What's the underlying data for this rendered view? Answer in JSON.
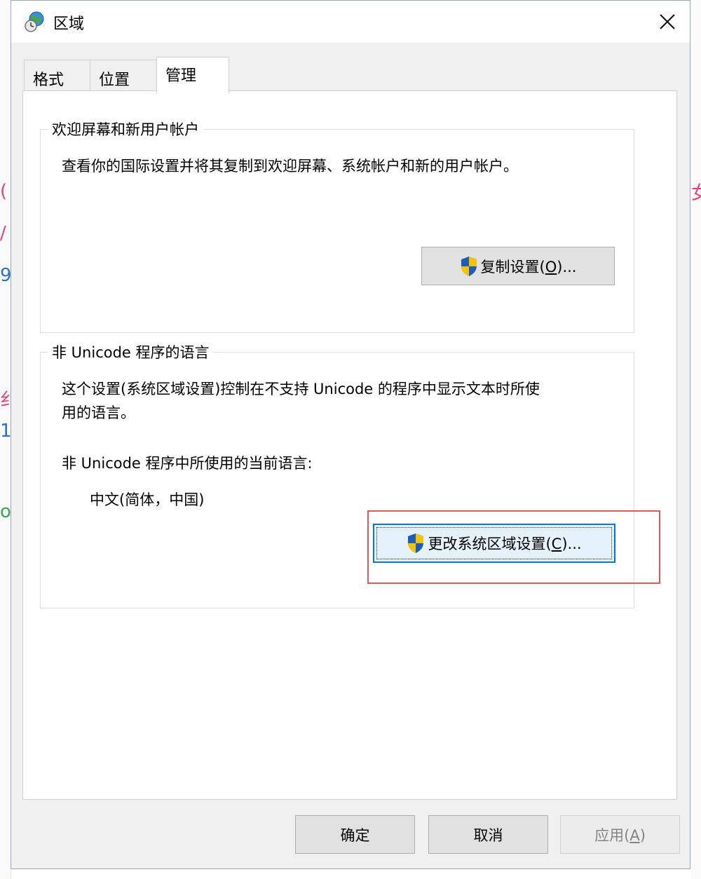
{
  "window": {
    "title": "区域",
    "close_glyph": "✕"
  },
  "tabs": [
    {
      "label": "格式",
      "active": false
    },
    {
      "label": "位置",
      "active": false
    },
    {
      "label": "管理",
      "active": true
    }
  ],
  "welcome_group": {
    "label": "欢迎屏幕和新用户帐户",
    "description": "查看你的国际设置并将其复制到欢迎屏幕、系统帐户和新的用户帐户。",
    "copy_button": {
      "label_pre": "复制设置(",
      "mnemonic": "O",
      "label_post": ")..."
    }
  },
  "nonunicode_group": {
    "label": "非 Unicode 程序的语言",
    "description_line1": "这个设置(系统区域设置)控制在不支持 Unicode 的程序中显示文本时所使",
    "description_line2": "用的语言。",
    "current_label": "非 Unicode 程序中所使用的当前语言:",
    "current_value": "中文(简体，中国)",
    "change_button": {
      "label_pre": "更改系统区域设置(",
      "mnemonic": "C",
      "label_post": ")..."
    }
  },
  "footer": {
    "ok": "确定",
    "cancel": "取消",
    "apply": {
      "label_pre": "应用(",
      "mnemonic": "A",
      "label_post": ")"
    }
  },
  "background_fragments": [
    "(",
    "/",
    "9",
    "纟",
    "1",
    "o",
    "女"
  ],
  "colors": {
    "accent": "#0078d7",
    "highlight": "#e05a5a",
    "shield_blue": "#1e5bbf",
    "shield_yellow": "#f5c400"
  }
}
